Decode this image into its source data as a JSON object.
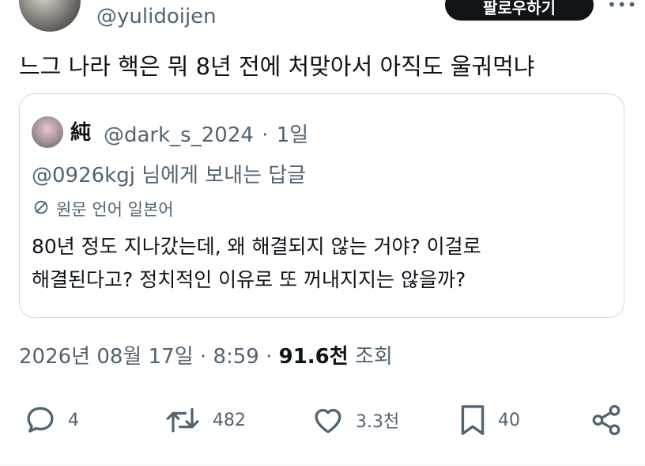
{
  "author": {
    "handle": "@yulidoijen",
    "follow_label": "팔로우하기"
  },
  "tweet": {
    "text": "느그 나라 핵은 뭐 8년 전에 처맞아서 아직도 울궈먹냐"
  },
  "quote": {
    "name": "純",
    "handle": "@dark_s_2024",
    "separator": "·",
    "time": "1일",
    "replying_to": "@0926kgj 님에게 보내는 답글",
    "translate_label": "원문 언어 일본어",
    "body_lines": [
      "80년 정도 지나갔는데, 왜 해결되지 않는 거야? 이걸로",
      "해결된다고? 정치적인 이유로 또 꺼내지지는 않을까?"
    ]
  },
  "meta": {
    "date": "2026년 08월 17일",
    "separator1": "·",
    "time": "8:59",
    "separator2": "·",
    "views_count": "91.6천",
    "views_label": "조회"
  },
  "actions": {
    "reply_count": "4",
    "retweet_count": "482",
    "like_count": "3.3천",
    "bookmark_count": "40"
  },
  "colors": {
    "text_primary": "#0f1419",
    "text_secondary": "#536471",
    "border": "#cfd9de",
    "follow_button": "#0f1419"
  },
  "icons": [
    "reply-icon",
    "retweet-icon",
    "like-icon",
    "bookmark-icon",
    "share-icon",
    "translate-icon",
    "more-icon"
  ]
}
